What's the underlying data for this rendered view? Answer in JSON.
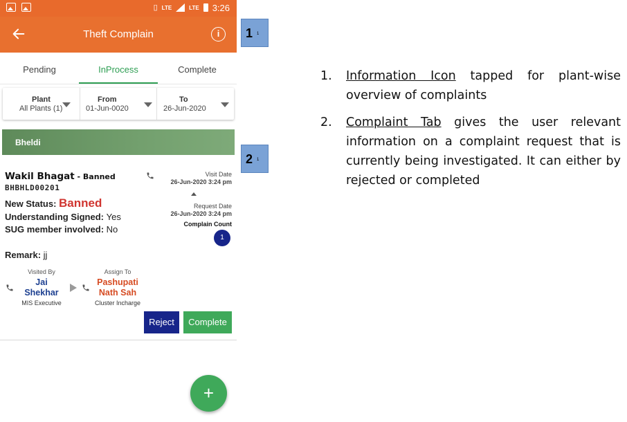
{
  "status_bar": {
    "lte_label": "LTE",
    "lte_label_2": "LTE",
    "time": "3:26",
    "icons": [
      "image-icon",
      "chart-icon",
      "vibrate-icon",
      "wifi-calling-icon",
      "signal-icon",
      "battery-icon"
    ]
  },
  "app_bar": {
    "title": "Theft Complain",
    "back_icon": "arrow-left-icon",
    "info_icon": "info-icon",
    "info_glyph": "i",
    "color": "#e8702f"
  },
  "tabs": [
    {
      "label": "Pending",
      "active": false
    },
    {
      "label": "InProcess",
      "active": true
    },
    {
      "label": "Complete",
      "active": false
    }
  ],
  "filters": {
    "plant": {
      "label": "Plant",
      "value": "All Plants (1)"
    },
    "from": {
      "label": "From",
      "value": "01-Jun-0020"
    },
    "to": {
      "label": "To",
      "value": "26-Jun-2020"
    }
  },
  "plant_header": "Bheldi",
  "complaint": {
    "name": "Wakil Bhagat",
    "name_suffix": " - Banned",
    "code": "BHBHLD00201",
    "new_status_label": "New Status: ",
    "new_status_value": "Banned",
    "understanding_label": "Understanding Signed: ",
    "understanding_value": "Yes",
    "sug_label": "SUG member involved: ",
    "sug_value": "No",
    "remark_label": "Remark: ",
    "remark_value": "jj",
    "visit_date_label": "Visit Date",
    "visit_date": "26-Jun-2020 3:24 pm",
    "request_date_label": "Request Date",
    "request_date": "26-Jun-2020 3:24 pm",
    "complain_count_label": "Complain Count",
    "complain_count": "1",
    "visited_by_label": "Visited By",
    "visited_by_name": "Jai Shekhar",
    "visited_by_title": "MIS Executive",
    "assign_to_label": "Assign To",
    "assign_to_name": "Pashupati Nath Sah",
    "assign_to_title": "Cluster Incharge",
    "reject_label": "Reject",
    "complete_label": "Complete"
  },
  "fab": {
    "glyph": "+",
    "icon": "plus-icon"
  },
  "callouts": [
    {
      "number": "1",
      "sub": "1"
    },
    {
      "number": "2",
      "sub": "1"
    }
  ],
  "notes": [
    {
      "num": "1.",
      "term": "Information Icon",
      "text": " tapped for plant-wise overview of complaints"
    },
    {
      "num": "2.",
      "term": "Complaint Tab",
      "text": " gives the user relevant information on a complaint request that is currently being investigated. It can either by rejected or completed"
    }
  ],
  "colors": {
    "app_bar": "#e8702f",
    "active_tab": "#2e9e53",
    "banned": "#d03530",
    "reject": "#17258a",
    "complete": "#3fa95a",
    "callout": "#7aa2d6"
  }
}
